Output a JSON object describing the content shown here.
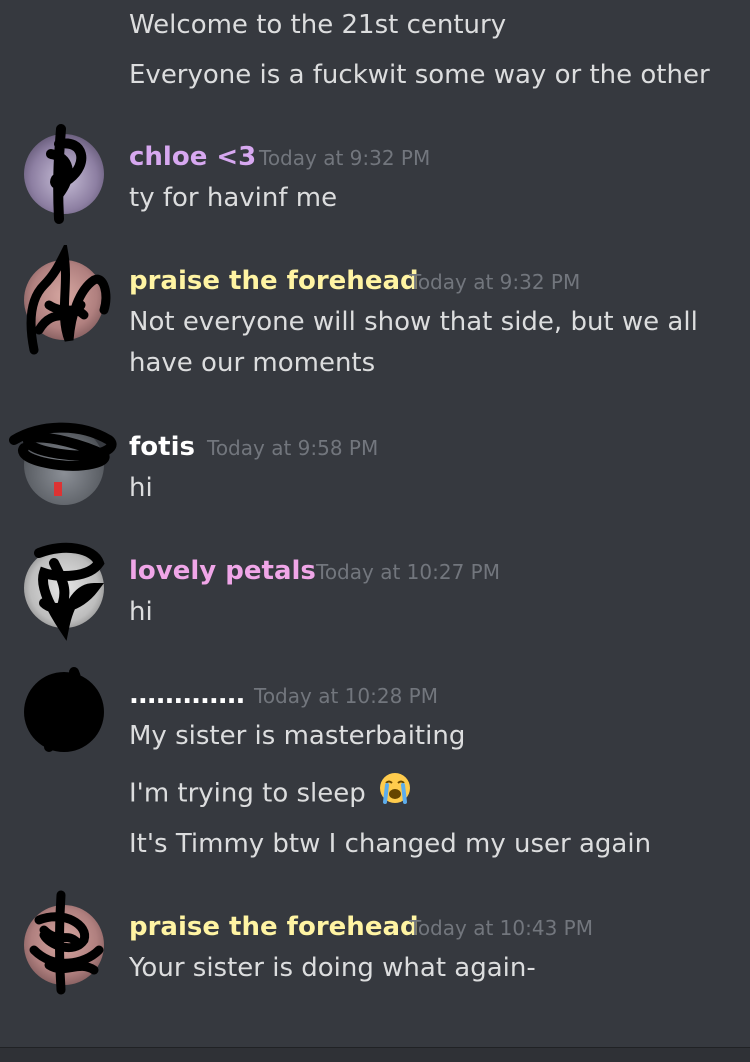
{
  "colors": {
    "background": "#36393f",
    "message_text": "#dcddde",
    "timestamp": "#72767d",
    "chloe": "#d7a8f0",
    "praise": "#fff4a3",
    "fotis": "#ffffff",
    "lovely": "#f0a6e8",
    "dots": "#ffffff"
  },
  "messages": [
    {
      "text": "Welcome to the 21st century"
    },
    {
      "text": "Everyone is a fuckwit some way or the other"
    },
    {
      "author": "chloe <3",
      "time": "Today at 9:32 PM",
      "lines": [
        "ty for havinf me"
      ]
    },
    {
      "author": "praise the forehead",
      "time": "Today at 9:32 PM",
      "lines": [
        "Not everyone will show that side, but we all",
        "have our moments"
      ]
    },
    {
      "author": "fotis",
      "time": "Today at 9:58 PM",
      "lines": [
        "hi"
      ]
    },
    {
      "author": "lovely petals",
      "time": "Today at 10:27 PM",
      "lines": [
        "hi"
      ]
    },
    {
      "author": ".............",
      "time": "Today at 10:28 PM",
      "lines": [
        "My sister is masterbaiting",
        "I'm trying to sleep",
        "It's Timmy btw I changed my user again"
      ]
    },
    {
      "author": "praise the forehead",
      "time": "Today at 10:43 PM",
      "lines": [
        "Your sister is doing what again-"
      ]
    }
  ],
  "icons": {
    "crying_emoji": "loudly-crying-face-icon"
  }
}
